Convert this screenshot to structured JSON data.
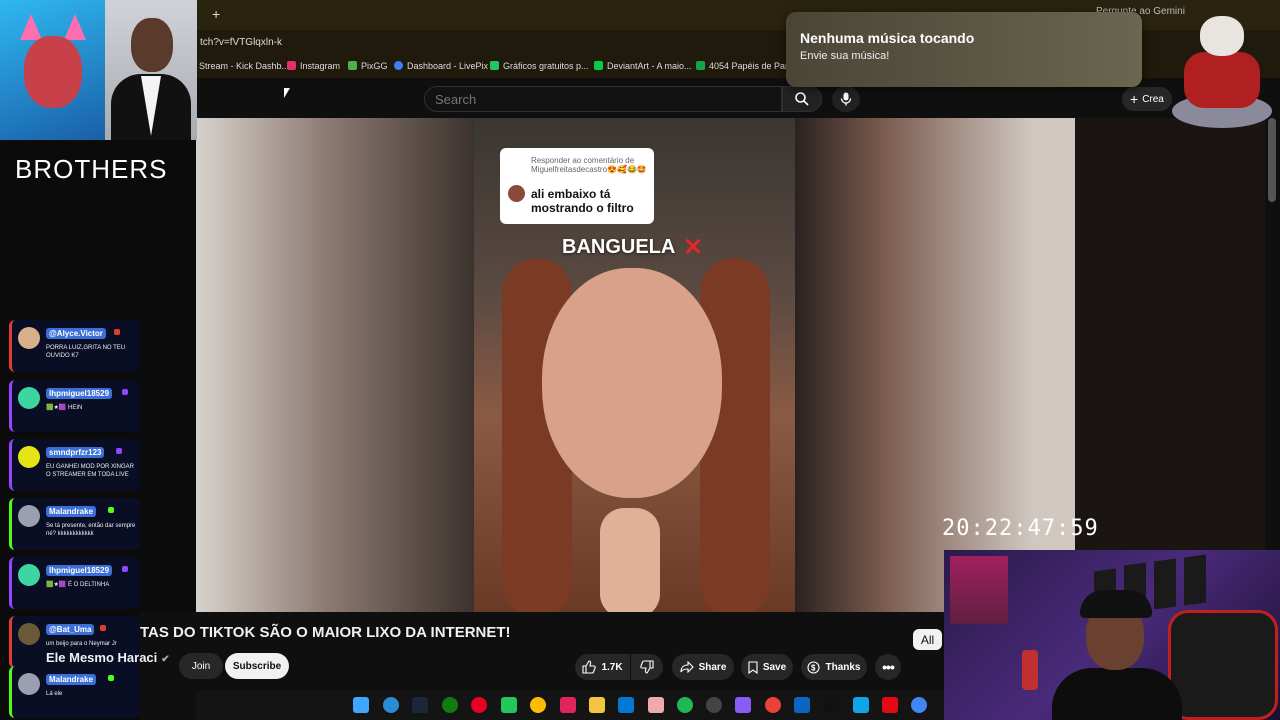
{
  "browser": {
    "new_tab": "+",
    "url": "tch?v=fVTGlqxln-k",
    "ask_gemini": "Pergunte ao Gemini",
    "bookmarks": [
      {
        "label": "Stream - Kick Dashb...",
        "color": "#53fc18"
      },
      {
        "label": "Instagram",
        "color": "#e1306c"
      },
      {
        "label": "PixGG",
        "color": "#4caf50"
      },
      {
        "label": "Dashboard - LivePix",
        "color": "#3b82f6"
      },
      {
        "label": "Gráficos gratuitos p...",
        "color": "#22c55e"
      },
      {
        "label": "DeviantArt - A maio...",
        "color": "#05cc47"
      },
      {
        "label": "4054 Papéis de Pare...",
        "color": "#16a34a"
      }
    ]
  },
  "notification": {
    "title": "Nenhuma música tocando",
    "subtitle": "Envie sua música!"
  },
  "youtube": {
    "search_placeholder": "Search",
    "create_label": "Crea",
    "video_title": "TAS DO TIKTOK SÃO O MAIOR LIXO DA INTERNET!",
    "channel_name": "Ele Mesmo Haraci",
    "join": "Join",
    "subscribe": "Subscribe",
    "like_count": "1.7K",
    "share": "Share",
    "save": "Save",
    "thanks": "Thanks",
    "all_chip": "All"
  },
  "video": {
    "comment_header": "Responder ao comentário de Miguelfreitasdecastro😍🥰😂🤩",
    "comment_text": "ali embaixo tá mostrando o filtro",
    "caption": "BANGUELA",
    "caption_mark": "✕"
  },
  "overlay": {
    "brothers": "BROTHERS",
    "clock": "20:22:47:59"
  },
  "chat": [
    {
      "user": "@Alyce.Victor",
      "msg": "PORRA LUIZ,GRITA NO TEU OUVIDO K7",
      "avatar": "#d8b08a"
    },
    {
      "user": "lhpmiguel18529",
      "msg": "🟩★🟪 HEIN",
      "avatar": "#3dd6a0"
    },
    {
      "user": "smndprfzr123",
      "msg": "EU GANHEI MOD POR XINGAR O STREAMER EM TODA LIVE",
      "avatar": "#e5e515"
    },
    {
      "user": "Malandrake",
      "msg": "Se tá presente, então dar sempre né? kkkkkkkkkkkk",
      "avatar": "#9aa0b0"
    },
    {
      "user": "lhpmiguel18529",
      "msg": "🟩★🟪 É O DELTINHA",
      "avatar": "#3dd6a0"
    },
    {
      "user": "@Bat_Uma",
      "msg": "um beijo para o Neymar Jr",
      "avatar": "#6a5a3a"
    },
    {
      "user": "Malandrake",
      "msg": "Lá ele",
      "avatar": "#9aa0b0"
    }
  ]
}
